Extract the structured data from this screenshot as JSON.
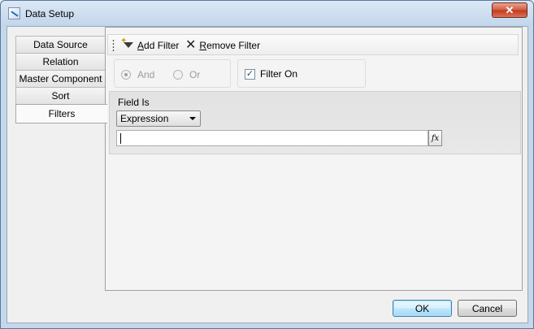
{
  "window": {
    "title": "Data Setup",
    "close_label": "✕"
  },
  "tabs": [
    {
      "label": "Data Source"
    },
    {
      "label": "Relation"
    },
    {
      "label": "Master Component"
    },
    {
      "label": "Sort"
    },
    {
      "label": "Filters"
    }
  ],
  "toolbar": {
    "add_filter": {
      "accel": "A",
      "rest": "dd Filter"
    },
    "remove_filter": {
      "accel": "R",
      "rest": "emove Filter"
    }
  },
  "logic": {
    "and_label": "And",
    "or_label": "Or",
    "selected": "And"
  },
  "filter_on": {
    "label": "Filter On",
    "checked": true,
    "mark": "✓"
  },
  "field": {
    "label": "Field Is",
    "selected": "Expression",
    "expression_value": "",
    "fx_label": "fx"
  },
  "buttons": {
    "ok": "OK",
    "cancel": "Cancel"
  }
}
